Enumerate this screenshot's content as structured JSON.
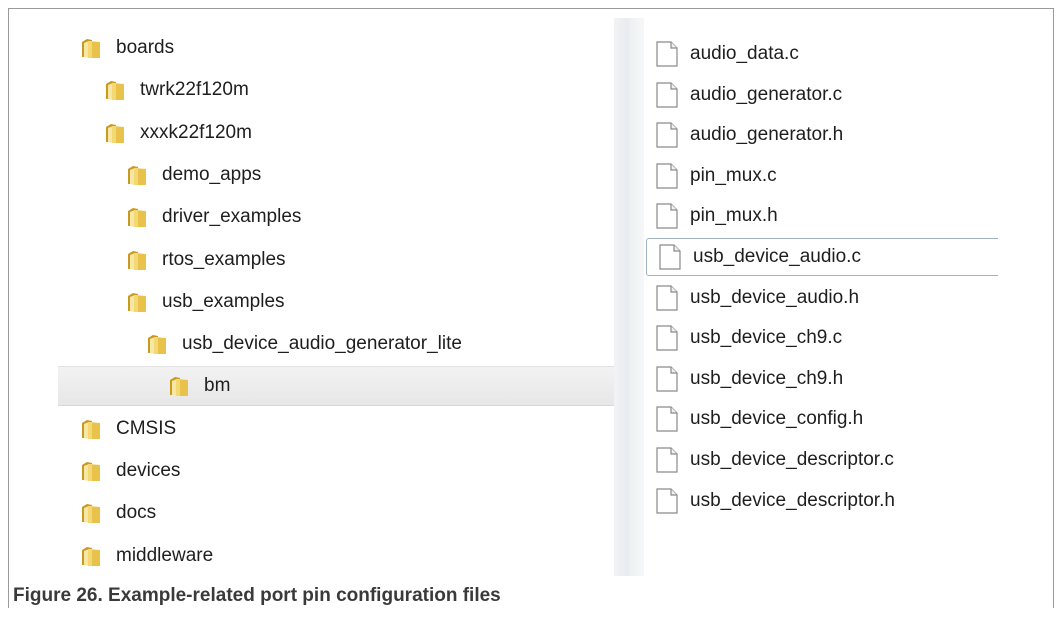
{
  "tree": {
    "items": [
      {
        "label": "boards",
        "level": 0,
        "selected": false
      },
      {
        "label": "twrk22f120m",
        "level": 1,
        "selected": false
      },
      {
        "label": "xxxk22f120m",
        "level": 1,
        "selected": false
      },
      {
        "label": "demo_apps",
        "level": 2,
        "selected": false
      },
      {
        "label": "driver_examples",
        "level": 2,
        "selected": false
      },
      {
        "label": "rtos_examples",
        "level": 2,
        "selected": false
      },
      {
        "label": "usb_examples",
        "level": 2,
        "selected": false
      },
      {
        "label": "usb_device_audio_generator_lite",
        "level": 3,
        "selected": false
      },
      {
        "label": "bm",
        "level": 4,
        "selected": true
      },
      {
        "label": "CMSIS",
        "level": 0,
        "selected": false
      },
      {
        "label": "devices",
        "level": 0,
        "selected": false
      },
      {
        "label": "docs",
        "level": 0,
        "selected": false
      },
      {
        "label": "middleware",
        "level": 0,
        "selected": false
      }
    ]
  },
  "files": {
    "items": [
      {
        "label": "audio_data.c",
        "focused": false
      },
      {
        "label": "audio_generator.c",
        "focused": false
      },
      {
        "label": "audio_generator.h",
        "focused": false
      },
      {
        "label": "pin_mux.c",
        "focused": false
      },
      {
        "label": "pin_mux.h",
        "focused": false
      },
      {
        "label": "usb_device_audio.c",
        "focused": true
      },
      {
        "label": "usb_device_audio.h",
        "focused": false
      },
      {
        "label": "usb_device_ch9.c",
        "focused": false
      },
      {
        "label": "usb_device_ch9.h",
        "focused": false
      },
      {
        "label": "usb_device_config.h",
        "focused": false
      },
      {
        "label": "usb_device_descriptor.c",
        "focused": false
      },
      {
        "label": "usb_device_descriptor.h",
        "focused": false
      }
    ]
  },
  "caption": "Figure 26.  Example-related port pin configuration files",
  "icons": {
    "folder": "folder-icon",
    "file": "file-icon"
  },
  "colors": {
    "folder_yellow": "#e8c24a",
    "folder_dark": "#c99a22",
    "selection": "#e7e7e7"
  }
}
